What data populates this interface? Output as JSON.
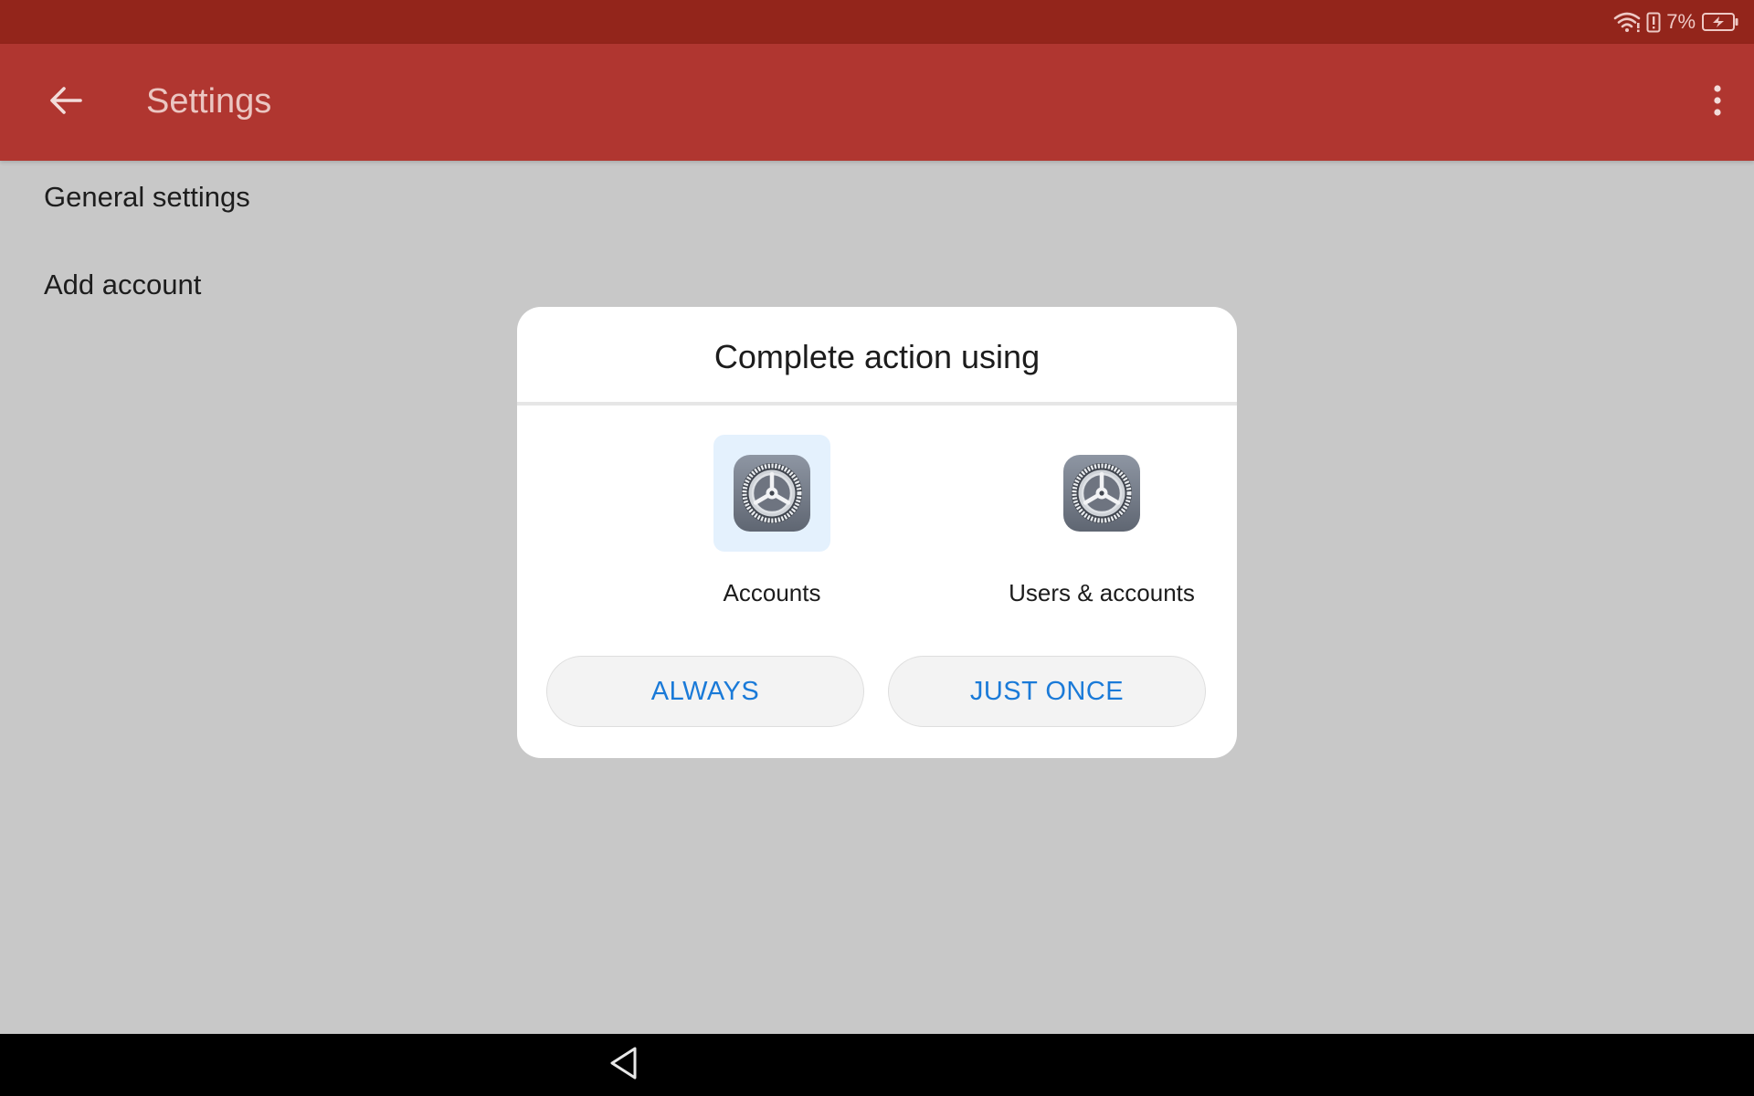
{
  "status_bar": {
    "battery_percent": "7%",
    "icons": [
      "wifi-icon",
      "battery-alert-icon",
      "battery-charging-icon"
    ]
  },
  "app_bar": {
    "title": "Settings",
    "back_icon": "arrow-back-icon",
    "menu_icon": "more-vertical-icon"
  },
  "settings": {
    "items": [
      {
        "label": "General settings"
      },
      {
        "label": "Add account"
      }
    ]
  },
  "dialog": {
    "title": "Complete action using",
    "options": [
      {
        "label": "Accounts",
        "icon": "settings-gear-icon",
        "selected": true
      },
      {
        "label": "Users & accounts",
        "icon": "settings-gear-icon",
        "selected": false
      }
    ],
    "buttons": {
      "always": "ALWAYS",
      "just_once": "JUST ONCE"
    }
  },
  "nav_bar": {
    "back_icon": "nav-back-triangle-icon"
  },
  "colors": {
    "status_bar": "#93251b",
    "app_bar": "#b03630",
    "scrim_background": "#c8c8c8",
    "dialog_button_text": "#1a7ad8",
    "selected_option_bg": "#e4f1fd"
  }
}
